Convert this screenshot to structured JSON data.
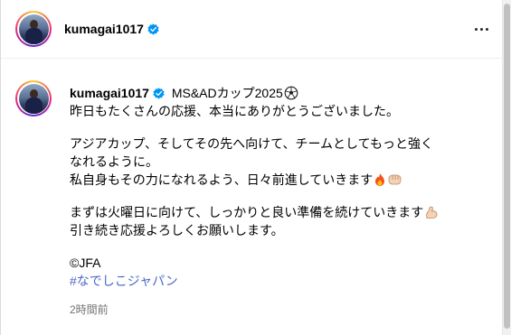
{
  "header": {
    "username": "kumagai1017",
    "more_icon": "more-horizontal-icon"
  },
  "post": {
    "username": "kumagai1017",
    "title": "MS&ADカップ2025",
    "title_emoji": "soccer-ball-icon",
    "lines": [
      "昨日もたくさんの応援、本当にありがとうございました。",
      "アジアカップ、そしてその先へ向けて、チームとしてもっと強く",
      "なれるように。",
      "私自身もその力になれるよう、日々前進していきます",
      "まずは火曜日に向けて、しっかりと良い準備を続けていきます",
      "引き続き応援よろしくお願いします。",
      "©JFA"
    ],
    "line4_emojis": [
      "fire-icon",
      "fist-icon"
    ],
    "line5_emoji": "flexed-biceps-icon",
    "hashtag": "#なでしこジャパン",
    "timestamp": "2時間前"
  },
  "colors": {
    "verified": "#0095f6",
    "hashtag": "#4a66c8",
    "muted": "#737373"
  }
}
